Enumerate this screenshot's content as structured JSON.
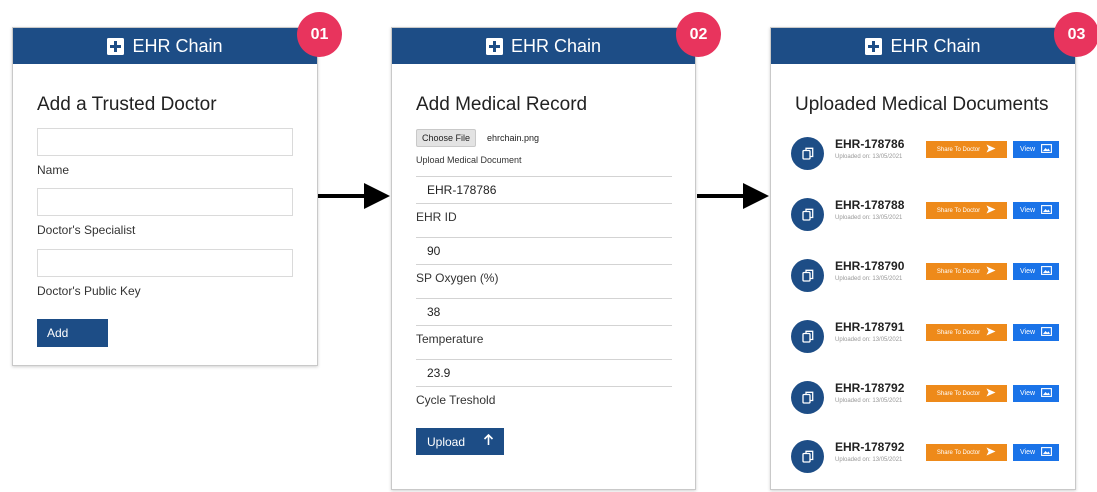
{
  "app": {
    "title": "EHR Chain"
  },
  "steps": [
    "01",
    "02",
    "03"
  ],
  "panel1": {
    "title": "Add a Trusted Doctor",
    "fields": [
      {
        "label": "Name",
        "value": ""
      },
      {
        "label": "Doctor's Specialist",
        "value": ""
      },
      {
        "label": "Doctor's Public Key",
        "value": ""
      }
    ],
    "add_label": "Add"
  },
  "panel2": {
    "title": "Add Medical Record",
    "choose_file_label": "Choose File",
    "file_name": "ehrchain.png",
    "upload_hint": "Upload Medical Document",
    "fields": [
      {
        "value": "EHR-178786",
        "label": "EHR ID"
      },
      {
        "value": "90",
        "label": "SP Oxygen (%)"
      },
      {
        "value": "38",
        "label": "Temperature"
      },
      {
        "value": "23.9",
        "label": "Cycle Treshold"
      }
    ],
    "upload_label": "Upload"
  },
  "panel3": {
    "title": "Uploaded Medical Documents",
    "share_label": "Share To Doctor",
    "view_label": "View",
    "documents": [
      {
        "id": "EHR-178786",
        "date": "Uploaded on: 13/05/2021"
      },
      {
        "id": "EHR-178788",
        "date": "Uploaded on: 13/05/2021"
      },
      {
        "id": "EHR-178790",
        "date": "Uploaded on: 13/05/2021"
      },
      {
        "id": "EHR-178791",
        "date": "Uploaded on: 13/05/2021"
      },
      {
        "id": "EHR-178792",
        "date": "Uploaded on: 13/05/2021"
      },
      {
        "id": "EHR-178792",
        "date": "Uploaded on: 13/05/2021"
      }
    ]
  },
  "colors": {
    "header": "#1d4d86",
    "badge": "#e8345d",
    "share": "#ee8a1a",
    "view": "#1a73e8"
  },
  "icons": {
    "header": "plus-box-icon",
    "document": "document-copy-icon",
    "share": "send-icon",
    "view": "image-icon",
    "upload": "arrow-up-icon",
    "flow": "arrow-right-icon"
  }
}
